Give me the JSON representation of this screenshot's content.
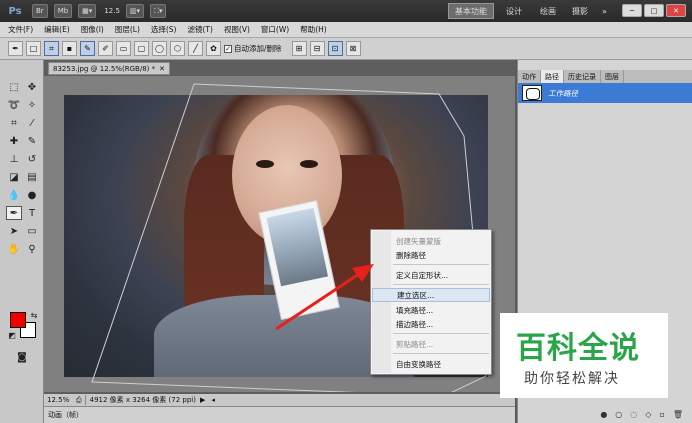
{
  "app": {
    "logo": "Ps",
    "bridge_btn": "Br",
    "minibridge_btn": "Mb",
    "zoom": "12.5",
    "workspaces": [
      "基本功能",
      "设计",
      "绘画",
      "摄影"
    ],
    "more": "»",
    "window_controls": [
      "─",
      "□",
      "✕"
    ]
  },
  "menus": [
    "文件(F)",
    "编辑(E)",
    "图像(I)",
    "图层(L)",
    "选择(S)",
    "滤镜(T)",
    "视图(V)",
    "窗口(W)",
    "帮助(H)"
  ],
  "options": {
    "auto_add_delete_label": "自动添加/删除",
    "auto_add_delete_checked": true
  },
  "document": {
    "tab_title": "83253.jpg @ 12.5%(RGB/8) *",
    "status_zoom": "12.5%",
    "status_info": "4912 像素 x 3264 像素 (72 ppi)"
  },
  "context_menu": {
    "items": [
      {
        "label": "创建矢量蒙版",
        "disabled": true
      },
      {
        "label": "删除路径",
        "disabled": false
      },
      {
        "label": "定义自定形状...",
        "disabled": false
      },
      {
        "label": "建立选区...",
        "disabled": false,
        "highlighted": true
      },
      {
        "label": "填充路径...",
        "disabled": false
      },
      {
        "label": "描边路径...",
        "disabled": false
      },
      {
        "label": "剪贴路径...",
        "disabled": true
      },
      {
        "label": "自由变换路径",
        "disabled": false
      }
    ]
  },
  "panels": {
    "tabs": [
      "动作",
      "路径",
      "历史记录",
      "图层"
    ],
    "active_tab": "路径",
    "path_item": "工作路径"
  },
  "animation_panel": "动画（帧）",
  "watermark": {
    "title": "百科全说",
    "subtitle": "助你轻松解决"
  },
  "colors": {
    "foreground": "#f20000",
    "background": "#ffffff",
    "selection_blue": "#3b7bd6",
    "watermark_green": "#2aa54a"
  }
}
